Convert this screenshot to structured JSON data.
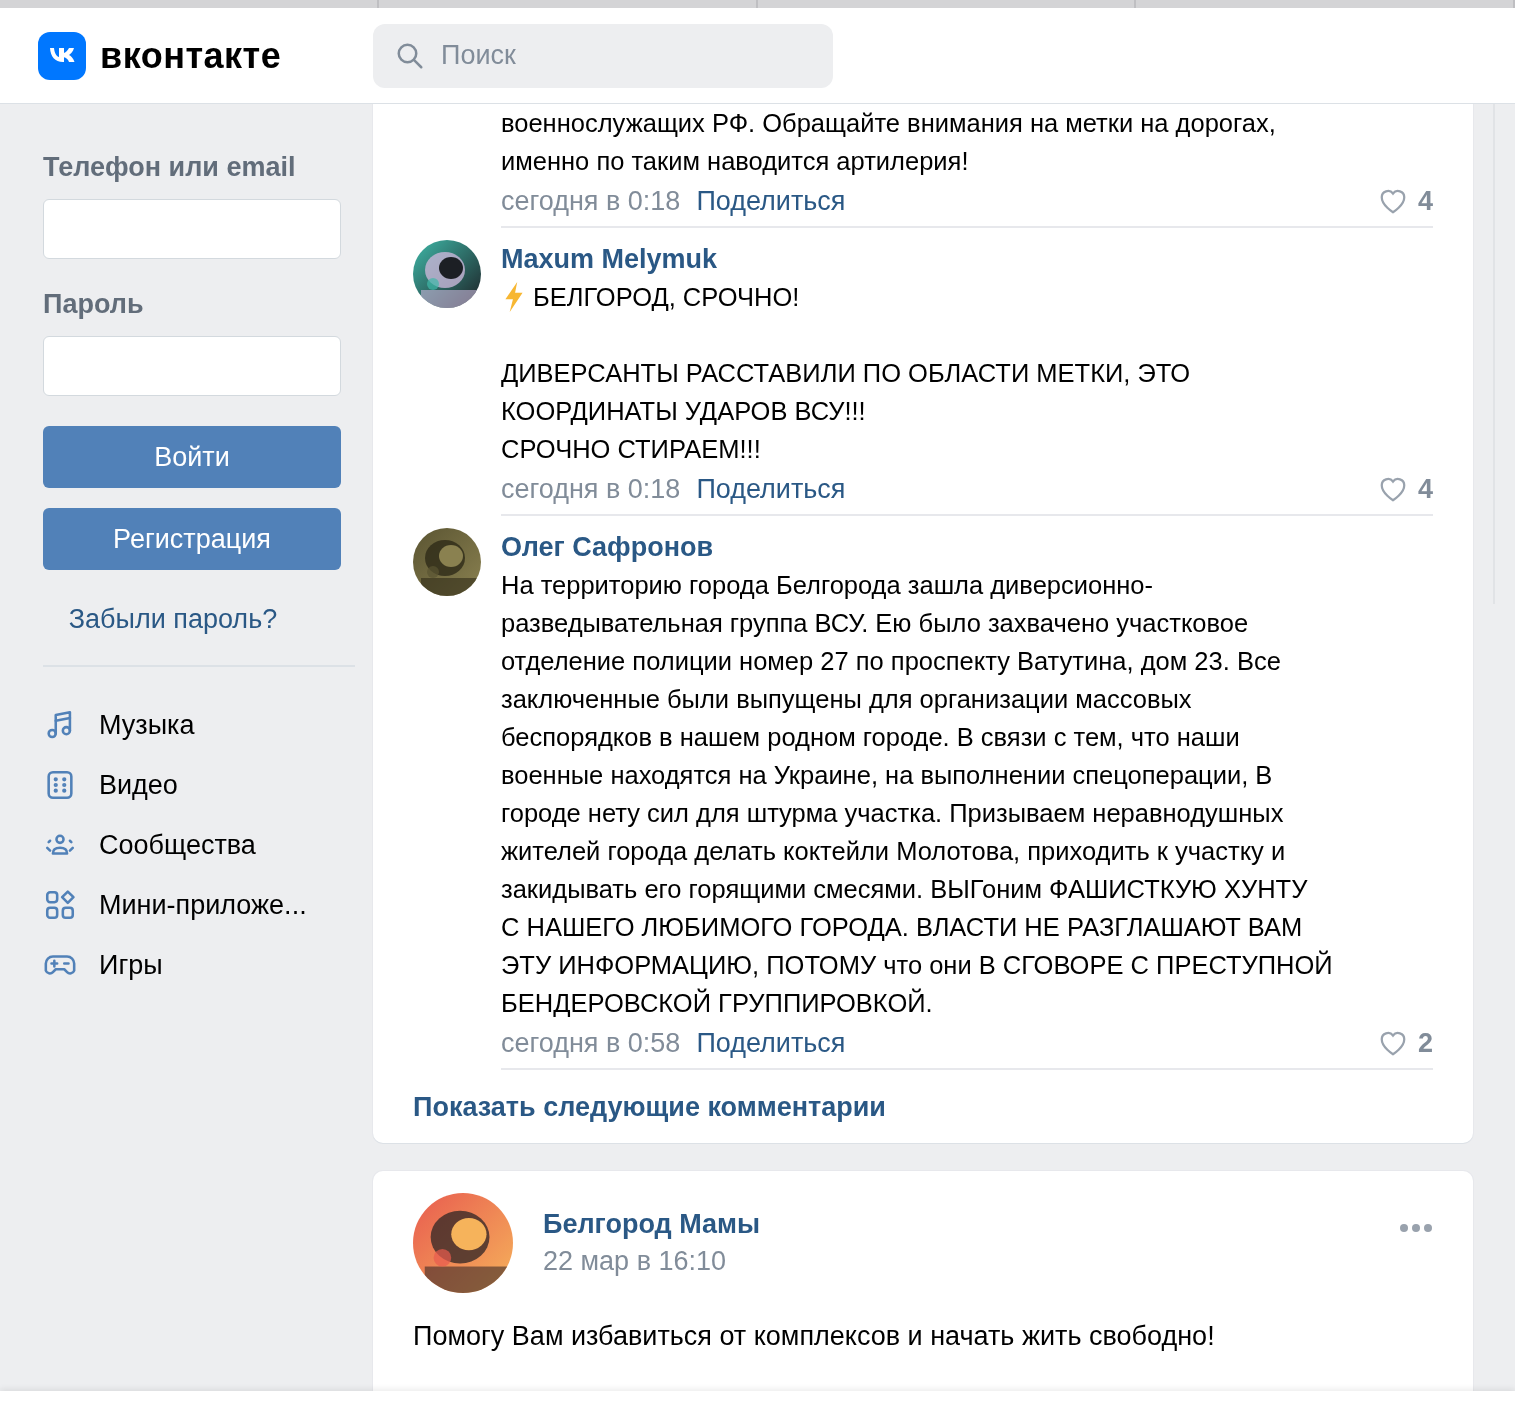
{
  "header": {
    "logo_text": "вконтакте",
    "search": {
      "placeholder": "Поиск"
    }
  },
  "login": {
    "fields": [
      {
        "label": "Телефон или email"
      },
      {
        "label": "Пароль"
      }
    ],
    "buttons": [
      "Войти",
      "Регистрация"
    ],
    "forgot_link": "Забыли пароль?"
  },
  "sidebar": {
    "items": [
      {
        "label": "Музыка",
        "kind": "music"
      },
      {
        "label": "Видео",
        "kind": "video"
      },
      {
        "label": "Сообщества",
        "kind": "groups"
      },
      {
        "label": "Мини-приложе...",
        "kind": "apps"
      },
      {
        "label": "Игры",
        "kind": "games"
      }
    ]
  },
  "comments": [
    {
      "kind": "plain",
      "paragraphs": [
        [
          "военнослужащих РФ. Обращайте внимания на метки на дорогах,",
          "именно по таким наводится артилерия!"
        ]
      ],
      "time": "сегодня в 0:18",
      "share": "Поделиться",
      "likes": "4"
    },
    {
      "kind": "urgent",
      "author": "Maxum Melymuk",
      "paragraphs": [
        [
          "БЕЛГОРОД, СРОЧНО!"
        ],
        [
          "ДИВЕРСАНТЫ РАССТАВИЛИ ПО ОБЛАСТИ МЕТКИ, ЭТО",
          "КООРДИНАТЫ УДАРОВ ВСУ!!!",
          "СРОЧНО СТИРАЕМ!!!"
        ]
      ],
      "time": "сегодня в 0:18",
      "share": "Поделиться",
      "likes": "4"
    },
    {
      "kind": "plain",
      "author": "Олег Сафронов",
      "paragraphs": [
        [
          "На территорию города Белгорода зашла диверсионно-",
          "разведывательная группа ВСУ. Ею было захвачено участковое",
          "отделение полиции номер 27 по проспекту Ватутина, дом 23. Все",
          "заключенные были выпущены для организации массовых",
          "беспорядков в нашем родном городе. В связи с тем, что наши",
          "военные находятся на Украине, на выполнении спецоперации, В",
          "городе нету сил для штурма участка. Призываем неравнодушных",
          "жителей города делать коктейли Молотова, приходить к участку и",
          "закидывать его горящими смесями. ВЫГоним ФАШИСТКУЮ ХУНТУ",
          "С НАШЕГО ЛЮБИМОГО ГОРОДА. ВЛАСТИ НЕ РАЗГЛАШАЮТ ВАМ",
          "ЭТУ ИНФОРМАЦИЮ, ПОТОМУ что они В СГОВОРЕ С ПРЕСТУПНОЙ",
          "БЕНДЕРОВСКОЙ ГРУППИРОВКОЙ."
        ]
      ],
      "time": "сегодня в 0:58",
      "share": "Поделиться",
      "likes": "2"
    }
  ],
  "show_more": "Показать следующие комментарии",
  "post": {
    "author": "Белгород Мамы",
    "date": "22 мар в 16:10",
    "text": "Помогу Вам избавиться от комплексов и начать жить свободно!"
  }
}
